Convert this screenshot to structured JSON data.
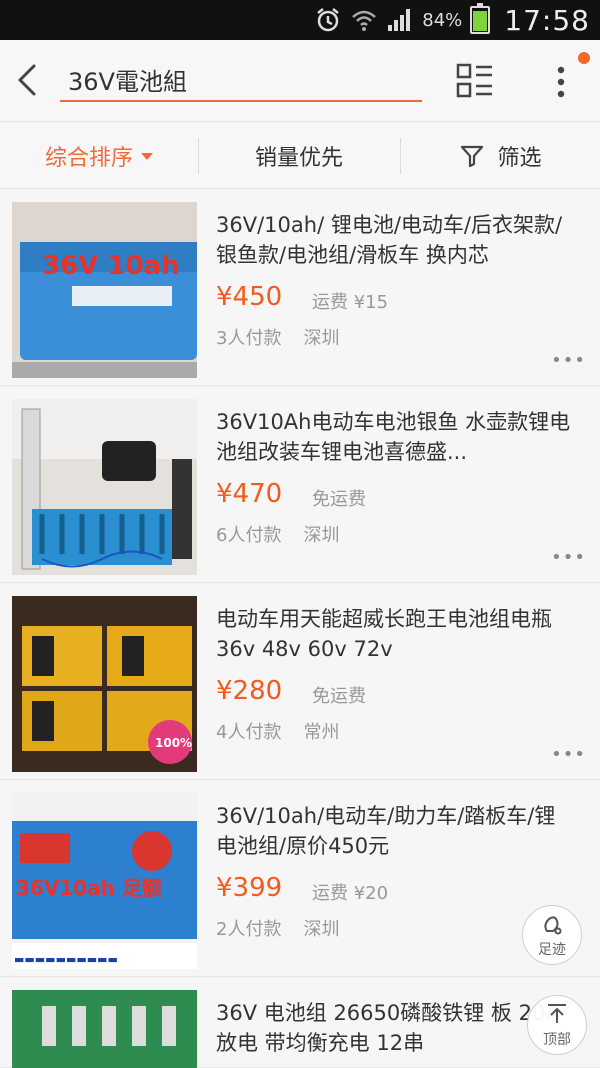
{
  "status_bar": {
    "battery": "84%",
    "time": "17:58"
  },
  "search": {
    "query": "36V電池組"
  },
  "sort_tabs": [
    {
      "label": "综合排序",
      "active": true
    },
    {
      "label": "销量优先",
      "active": false
    },
    {
      "label": "筛选",
      "active": false
    }
  ],
  "products": [
    {
      "title": "36V/10ah/ 锂电池/电动车/后衣架款/银鱼款/电池组/滑板车 换内芯",
      "price": "¥450",
      "shipping": "运费 ¥15",
      "buyers": "3人付款",
      "city": "深圳",
      "thumb_text": "36V 10ah"
    },
    {
      "title": "36V10Ah电动车电池银鱼 水壶款锂电池组改装车锂电池喜德盛...",
      "price": "¥470",
      "shipping": "免运费",
      "buyers": "6人付款",
      "city": "深圳",
      "thumb_text": ""
    },
    {
      "title": "电动车用天能超威长跑王电池组电瓶 36v 48v 60v 72v",
      "price": "¥280",
      "shipping": "免运费",
      "buyers": "4人付款",
      "city": "常州",
      "thumb_text": "100%"
    },
    {
      "title": "36V/10ah/电动车/助力车/踏板车/锂电池组/原价450元",
      "price": "¥399",
      "shipping": "运费 ¥20",
      "buyers": "2人付款",
      "city": "深圳",
      "thumb_text": "36V10ah 足额"
    },
    {
      "title": "36V 电池组 26650磷酸铁锂 板 20A放电 带均衡充电 12串",
      "price": "",
      "shipping": "",
      "buyers": "",
      "city": "",
      "thumb_text": ""
    }
  ],
  "floating": {
    "footprint_label": "足迹",
    "top_label": "顶部"
  },
  "colors": {
    "accent": "#ef6b3b",
    "price": "#f45a1e",
    "notify": "#f46a28"
  }
}
